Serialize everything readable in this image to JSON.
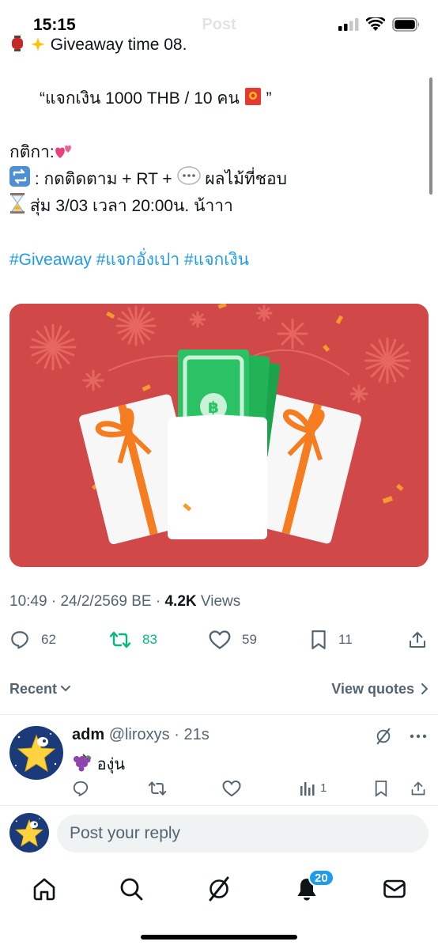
{
  "status_bar": {
    "time": "15:15",
    "header_ghost": "Post"
  },
  "tweet": {
    "line_cut": "Giveaway time 08.",
    "line_quote_open": "“แจกเงิน 1000 THB / 10 คน",
    "line_quote_close": "”",
    "rules_label": "กติกา:",
    "rule_follow": ": กดติดตาม + RT +",
    "rule_fruit": "ผลไม้ที่ชอบ",
    "rule_draw": "สุ่ม 3/03 เวลา 20:00น. น้าาา",
    "hashtags": [
      "#Giveaway",
      "#แจกอั่งเปา",
      "#แจกเงิน"
    ]
  },
  "meta": {
    "time": "10:49",
    "date": "24/2/2569 BE",
    "views_count": "4.2K",
    "views_label": "Views"
  },
  "actions": {
    "replies": "62",
    "reposts": "83",
    "likes": "59",
    "bookmarks": "11"
  },
  "recent": {
    "sort_label": "Recent",
    "view_quotes_label": "View quotes"
  },
  "reply": {
    "name": "adm",
    "handle": "@liroxys",
    "time": "21s",
    "text": "องุ่น",
    "views": "1"
  },
  "compose": {
    "placeholder": "Post your reply"
  },
  "nav": {
    "notifications_badge": "20"
  },
  "colors": {
    "accent": "#1d9bf0",
    "repost_green": "#00ba7c",
    "media_bg": "#d04848"
  }
}
